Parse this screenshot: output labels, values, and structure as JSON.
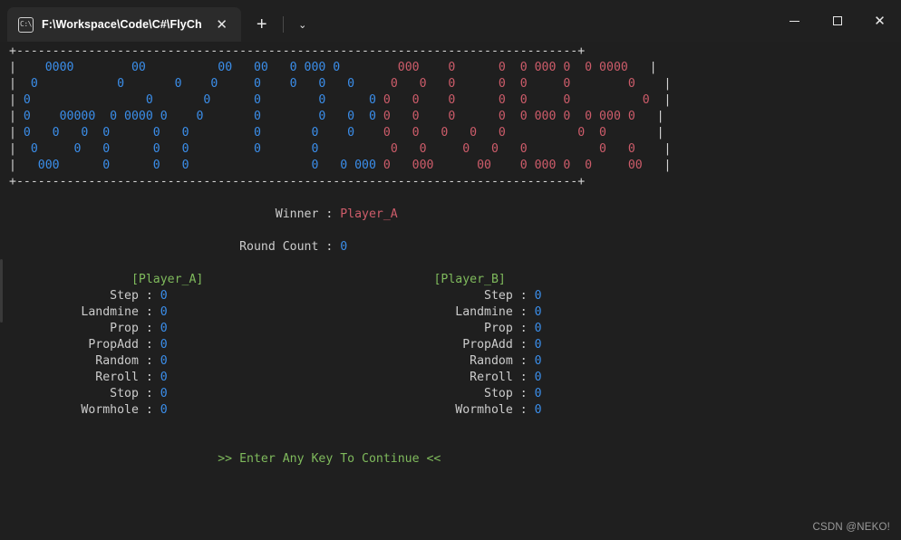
{
  "window": {
    "tab": {
      "title": "F:\\Workspace\\Code\\C#\\FlyCh",
      "icon": "terminal-icon",
      "close_label": "✕"
    },
    "new_tab_label": "+",
    "tab_menu_label": "⌄",
    "controls": {
      "minimize_label": "─",
      "maximize_label": "□",
      "close_label": "✕"
    }
  },
  "console": {
    "banner": {
      "border_top": "+------------------------------------------------------------------------------+",
      "border_bottom": "+------------------------------------------------------------------------------+",
      "rows": [
        {
          "left": "|",
          "blue": "    0000        00          00   00   0 000 0      ",
          "red": "  000    0      0  0 000 0  0 0000",
          "right": "   |"
        },
        {
          "left": "|",
          "blue": "  0           0       0    0     0    0   0   0    ",
          "red": " 0   0   0      0  0     0        0   ",
          "right": " |"
        },
        {
          "left": "|",
          "blue": " 0                0       0      0        0      0 ",
          "red": "0   0    0      0  0     0          0 ",
          "right": " |"
        },
        {
          "left": "|",
          "blue": " 0    00000  0 0000 0    0       0        0   0  0 ",
          "red": "0   0    0      0  0 000 0  0 000 0 ",
          "right": "  |"
        },
        {
          "left": "|",
          "blue": " 0   0   0  0      0   0         0       0    0    ",
          "red": "0   0   0   0   0          0  0     ",
          "right": "  |"
        },
        {
          "left": "|",
          "blue": "  0     0   0      0   0         0       0         ",
          "red": " 0   0     0   0   0          0   0   ",
          "right": " |"
        },
        {
          "left": "|",
          "blue": "   000      0      0   0                 0   0 000 ",
          "red": "0   000      00    0 000 0  0     00  ",
          "right": " |"
        }
      ]
    },
    "winner": {
      "label": "Winner : ",
      "value": "Player_A"
    },
    "round_count": {
      "label": "Round Count : ",
      "value": "0"
    },
    "players": [
      {
        "header": "[Player_A]",
        "stats": [
          {
            "label": "Step",
            "value": "0"
          },
          {
            "label": "Landmine",
            "value": "0"
          },
          {
            "label": "Prop",
            "value": "0"
          },
          {
            "label": "PropAdd",
            "value": "0"
          },
          {
            "label": "Random",
            "value": "0"
          },
          {
            "label": "Reroll",
            "value": "0"
          },
          {
            "label": "Stop",
            "value": "0"
          },
          {
            "label": "Wormhole",
            "value": "0"
          }
        ]
      },
      {
        "header": "[Player_B]",
        "stats": [
          {
            "label": "Step",
            "value": "0"
          },
          {
            "label": "Landmine",
            "value": "0"
          },
          {
            "label": "Prop",
            "value": "0"
          },
          {
            "label": "PropAdd",
            "value": "0"
          },
          {
            "label": "Random",
            "value": "0"
          },
          {
            "label": "Reroll",
            "value": "0"
          },
          {
            "label": "Stop",
            "value": "0"
          },
          {
            "label": "Wormhole",
            "value": "0"
          }
        ]
      }
    ],
    "prompt": ">> Enter Any Key To Continue <<",
    "watermark": "CSDN @NEKO!"
  },
  "colors": {
    "blue": "#3b8eea",
    "red": "#cd5c6a",
    "green": "#7fba5c",
    "gray": "#cccccc",
    "background": "#1f1f1f",
    "chrome": "#202020",
    "tab": "#2b2b2b"
  }
}
